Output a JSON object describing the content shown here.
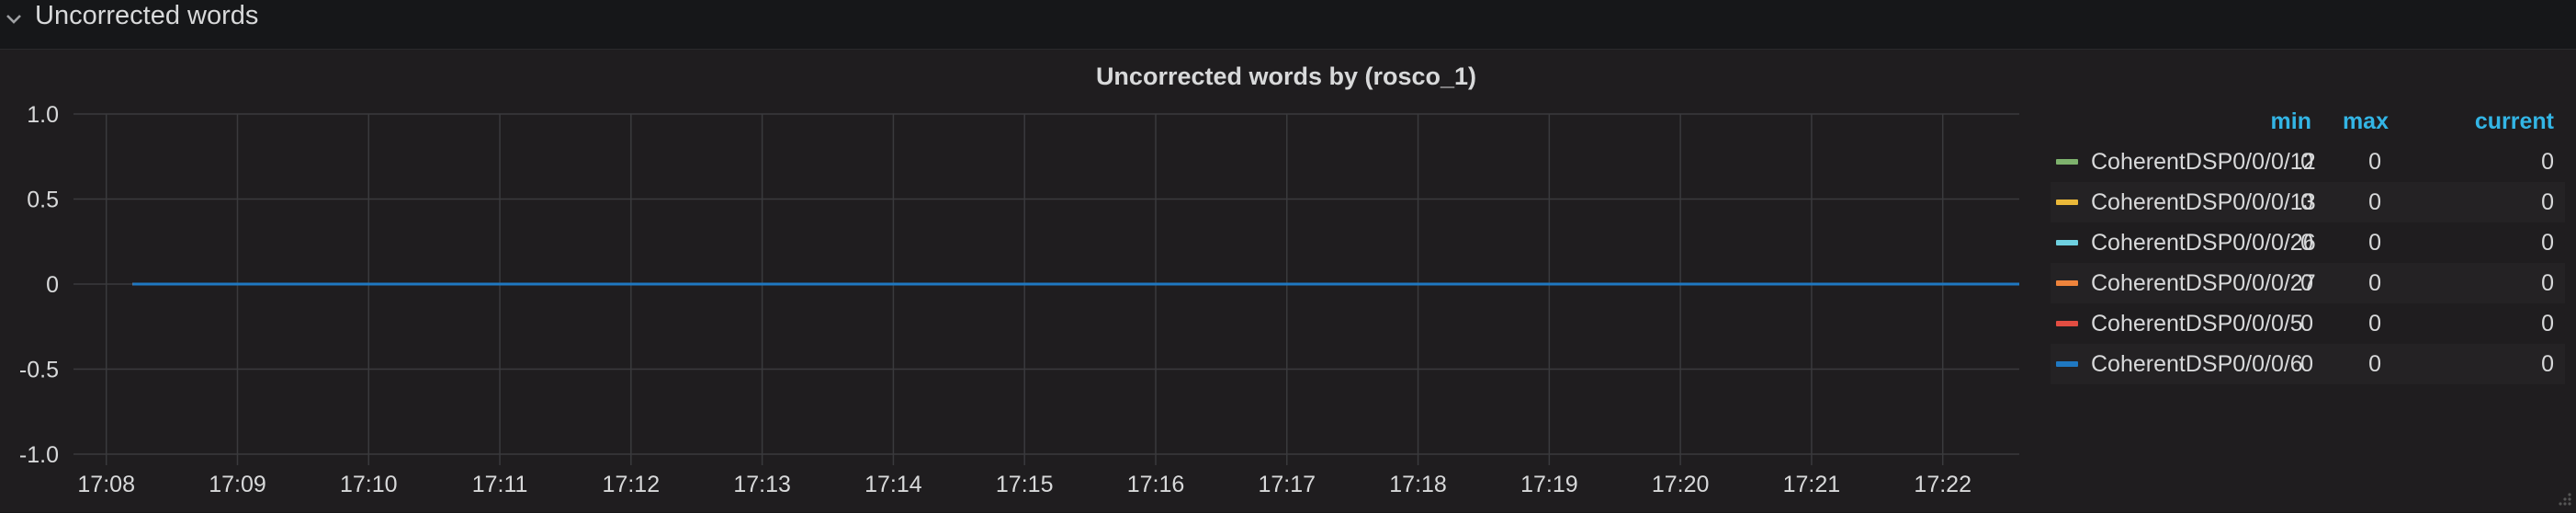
{
  "row": {
    "title": "Uncorrected words",
    "chevron_icon": "chevron-down-icon"
  },
  "panel": {
    "title": "Uncorrected words by (rosco_1)"
  },
  "legend": {
    "headers": {
      "min": "min",
      "max": "max",
      "current": "current"
    },
    "items": [
      {
        "name": "CoherentDSP0/0/0/12",
        "color": "#7eb26d",
        "min": "0",
        "max": "0",
        "current": "0"
      },
      {
        "name": "CoherentDSP0/0/0/13",
        "color": "#eab839",
        "min": "0",
        "max": "0",
        "current": "0"
      },
      {
        "name": "CoherentDSP0/0/0/26",
        "color": "#6ed0e0",
        "min": "0",
        "max": "0",
        "current": "0"
      },
      {
        "name": "CoherentDSP0/0/0/27",
        "color": "#ef843c",
        "min": "0",
        "max": "0",
        "current": "0"
      },
      {
        "name": "CoherentDSP0/0/0/5",
        "color": "#e24d42",
        "min": "0",
        "max": "0",
        "current": "0"
      },
      {
        "name": "CoherentDSP0/0/0/6",
        "color": "#1f78c1",
        "min": "0",
        "max": "0",
        "current": "0"
      }
    ]
  },
  "chart_data": {
    "type": "line",
    "title": "Uncorrected words by (rosco_1)",
    "xlabel": "",
    "ylabel": "",
    "x_tick_labels": [
      "17:08",
      "17:09",
      "17:10",
      "17:11",
      "17:12",
      "17:13",
      "17:14",
      "17:15",
      "17:16",
      "17:17",
      "17:18",
      "17:19",
      "17:20",
      "17:21",
      "17:22"
    ],
    "y_tick_labels": [
      "1.0",
      "0.5",
      "0",
      "-0.5",
      "-1.0"
    ],
    "y_ticks": [
      1.0,
      0.5,
      0,
      -0.5,
      -1.0
    ],
    "ylim": [
      -1.0,
      1.0
    ],
    "xlim": [
      "17:07:45",
      "17:22:35"
    ],
    "grid": true,
    "legend_position": "right",
    "series": [
      {
        "name": "CoherentDSP0/0/0/12",
        "color": "#7eb26d",
        "x": [
          "17:08:12",
          "17:22:35"
        ],
        "values": [
          0,
          0
        ]
      },
      {
        "name": "CoherentDSP0/0/0/13",
        "color": "#eab839",
        "x": [
          "17:08:12",
          "17:22:35"
        ],
        "values": [
          0,
          0
        ]
      },
      {
        "name": "CoherentDSP0/0/0/26",
        "color": "#6ed0e0",
        "x": [
          "17:08:12",
          "17:22:35"
        ],
        "values": [
          0,
          0
        ]
      },
      {
        "name": "CoherentDSP0/0/0/27",
        "color": "#ef843c",
        "x": [
          "17:08:12",
          "17:22:35"
        ],
        "values": [
          0,
          0
        ]
      },
      {
        "name": "CoherentDSP0/0/0/5",
        "color": "#e24d42",
        "x": [
          "17:08:12",
          "17:22:35"
        ],
        "values": [
          0,
          0
        ]
      },
      {
        "name": "CoherentDSP0/0/0/6",
        "color": "#1f78c1",
        "x": [
          "17:08:12",
          "17:22:35"
        ],
        "values": [
          0,
          0
        ]
      }
    ]
  }
}
